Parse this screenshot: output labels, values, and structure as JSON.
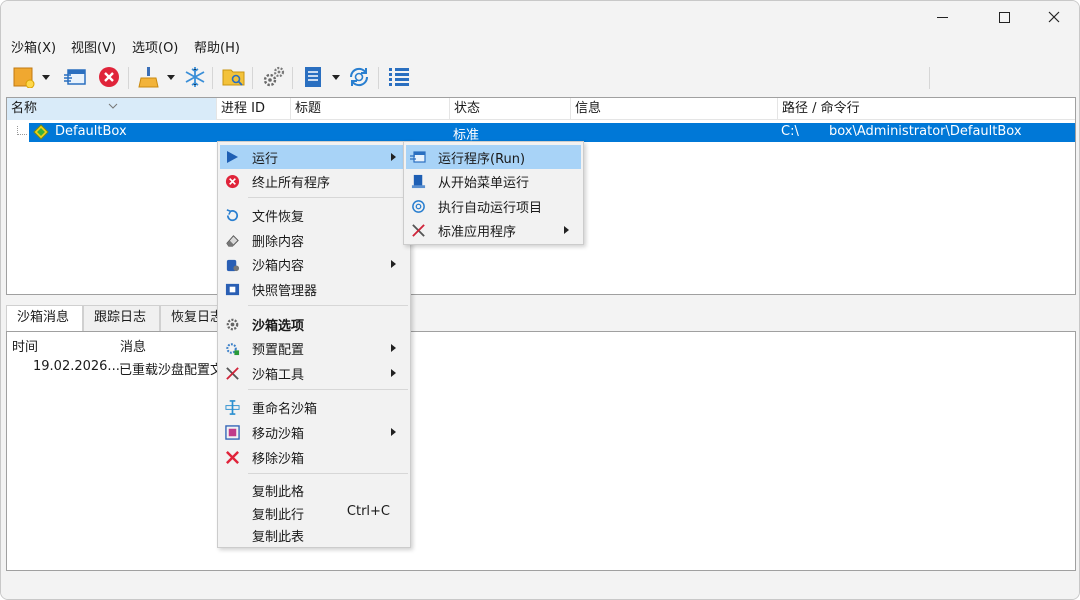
{
  "window": {
    "controls": {
      "minimize": "minimize-icon",
      "maximize": "maximize-icon",
      "close": "close-icon"
    }
  },
  "menubar": {
    "items": [
      "沙箱(X)",
      "视图(V)",
      "选项(O)",
      "帮助(H)"
    ]
  },
  "toolbar": {
    "icons": [
      "new-box-icon",
      "run-program-icon",
      "terminate-icon",
      "cleanup-icon",
      "freeze-icon",
      "explorer-icon",
      "settings-icon",
      "list-view-icon",
      "refresh-icon",
      "details-icon"
    ]
  },
  "tree": {
    "columns": [
      "名称",
      "进程 ID",
      "标题",
      "状态",
      "信息",
      "路径 / 命令行"
    ],
    "rows": [
      {
        "name": "DefaultBox",
        "status": "标准",
        "path_prefix": "C:\\",
        "path_suffix": "box\\Administrator\\DefaultBox"
      }
    ]
  },
  "bottom_tabs": [
    "沙箱消息",
    "跟踪日志",
    "恢复日志"
  ],
  "log": {
    "columns": [
      "时间",
      "消息"
    ],
    "rows": [
      {
        "time": "19.02.2026...",
        "message": "已重载沙盘配置文"
      }
    ]
  },
  "context_menu": {
    "items": [
      {
        "label": "运行",
        "icon": "play-icon",
        "submenu": true
      },
      {
        "label": "终止所有程序",
        "icon": "terminate-icon"
      },
      {
        "label": "文件恢复",
        "icon": "recover-icon"
      },
      {
        "label": "删除内容",
        "icon": "eraser-icon"
      },
      {
        "label": "沙箱内容",
        "icon": "box-content-icon",
        "submenu": true
      },
      {
        "label": "快照管理器",
        "icon": "snapshot-icon"
      },
      {
        "label": "沙箱选项",
        "icon": "gear-icon"
      },
      {
        "label": "预置配置",
        "icon": "preset-icon",
        "submenu": true
      },
      {
        "label": "沙箱工具",
        "icon": "tools-icon",
        "submenu": true
      },
      {
        "label": "重命名沙箱",
        "icon": "rename-icon"
      },
      {
        "label": "移动沙箱",
        "icon": "move-icon",
        "submenu": true
      },
      {
        "label": "移除沙箱",
        "icon": "remove-icon"
      },
      {
        "label": "复制此格"
      },
      {
        "label": "复制此行",
        "shortcut": "Ctrl+C"
      },
      {
        "label": "复制此表"
      }
    ]
  },
  "run_submenu": {
    "items": [
      {
        "label": "运行程序(Run)",
        "icon": "run-program-icon"
      },
      {
        "label": "从开始菜单运行",
        "icon": "start-menu-icon"
      },
      {
        "label": "执行自动运行项目",
        "icon": "autorun-icon"
      },
      {
        "label": "标准应用程序",
        "icon": "tools-icon",
        "submenu": true
      }
    ]
  },
  "colors": {
    "selection": "#0078d7",
    "menu_highlight": "#a8d3f7",
    "close_red": "#e0243a"
  }
}
